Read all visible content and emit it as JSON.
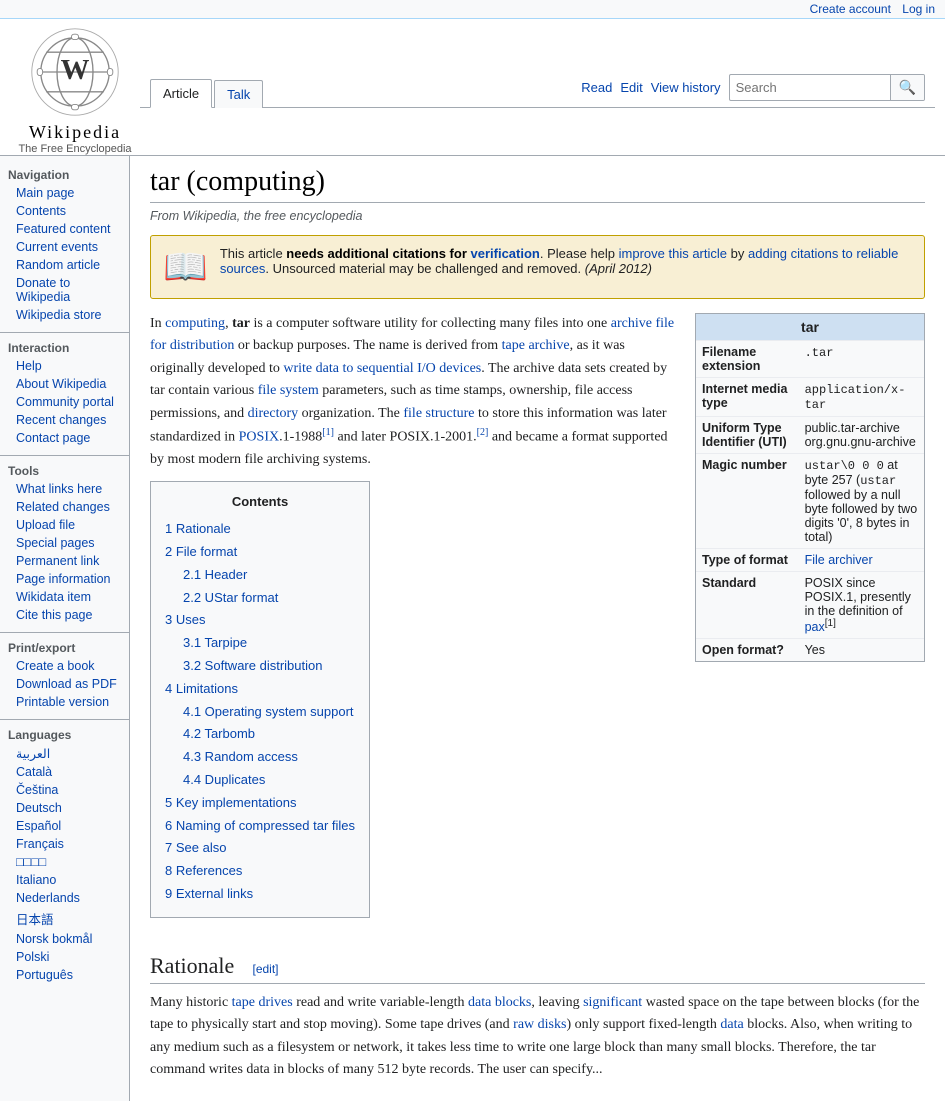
{
  "topbar": {
    "create_account": "Create account",
    "log_in": "Log in"
  },
  "logo": {
    "title": "Wikipedia",
    "subtitle": "The Free Encyclopedia"
  },
  "tabs": {
    "article": "Article",
    "talk": "Talk",
    "read": "Read",
    "edit": "Edit",
    "view_history": "View history"
  },
  "search": {
    "placeholder": "Search",
    "button_label": "🔍"
  },
  "sidebar": {
    "navigation_title": "Navigation",
    "nav_items": [
      {
        "label": "Main page",
        "href": "#"
      },
      {
        "label": "Contents",
        "href": "#"
      },
      {
        "label": "Featured content",
        "href": "#"
      },
      {
        "label": "Current events",
        "href": "#"
      },
      {
        "label": "Random article",
        "href": "#"
      },
      {
        "label": "Donate to Wikipedia",
        "href": "#"
      },
      {
        "label": "Wikipedia store",
        "href": "#"
      }
    ],
    "interaction_title": "Interaction",
    "interaction_items": [
      {
        "label": "Help",
        "href": "#"
      },
      {
        "label": "About Wikipedia",
        "href": "#"
      },
      {
        "label": "Community portal",
        "href": "#"
      },
      {
        "label": "Recent changes",
        "href": "#"
      },
      {
        "label": "Contact page",
        "href": "#"
      }
    ],
    "tools_title": "Tools",
    "tools_items": [
      {
        "label": "What links here",
        "href": "#"
      },
      {
        "label": "Related changes",
        "href": "#"
      },
      {
        "label": "Upload file",
        "href": "#"
      },
      {
        "label": "Special pages",
        "href": "#"
      },
      {
        "label": "Permanent link",
        "href": "#"
      },
      {
        "label": "Page information",
        "href": "#"
      },
      {
        "label": "Wikidata item",
        "href": "#"
      },
      {
        "label": "Cite this page",
        "href": "#"
      }
    ],
    "print_title": "Print/export",
    "print_items": [
      {
        "label": "Create a book",
        "href": "#"
      },
      {
        "label": "Download as PDF",
        "href": "#"
      },
      {
        "label": "Printable version",
        "href": "#"
      }
    ],
    "languages_title": "Languages",
    "language_items": [
      {
        "label": "العربية",
        "href": "#"
      },
      {
        "label": "Català",
        "href": "#"
      },
      {
        "label": "Čeština",
        "href": "#"
      },
      {
        "label": "Deutsch",
        "href": "#"
      },
      {
        "label": "Español",
        "href": "#"
      },
      {
        "label": "Français",
        "href": "#"
      },
      {
        "label": "□□□□",
        "href": "#"
      },
      {
        "label": "Italiano",
        "href": "#"
      },
      {
        "label": "Nederlands",
        "href": "#"
      },
      {
        "label": "日本語",
        "href": "#"
      },
      {
        "label": "Norsk bokmål",
        "href": "#"
      },
      {
        "label": "Polski",
        "href": "#"
      },
      {
        "label": "Português",
        "href": "#"
      }
    ]
  },
  "article": {
    "title": "tar (computing)",
    "subtitle": "From Wikipedia, the free encyclopedia",
    "warning": {
      "text_before": "This article ",
      "bold": "needs additional citations for ",
      "link_verification": "verification",
      "text_after": ". Please help ",
      "link_improve": "improve this article",
      "text_middle": " by adding citations to reliable sources",
      "link_citations": "adding citations to reliable sources",
      "text_end": ". Unsourced material may be challenged and removed.",
      "date": "(April 2012)"
    },
    "intro": "In computing, tar is a computer software utility for collecting many files into one archive file for distribution or backup purposes. The name is derived from tape archive, as it was originally developed to write data to sequential I/O devices. The archive data sets created by tar contain various file system parameters, such as time stamps, ownership, file access permissions, and directory organization. The file structure to store this information was later standardized in POSIX.1-1988[1] and later POSIX.1-2001.[2] and became a format supported by most modern file archiving systems.",
    "infobox": {
      "title": "tar",
      "rows": [
        {
          "label": "Filename extension",
          "value": ".tar"
        },
        {
          "label": "Internet media type",
          "value": "application/x-tar"
        },
        {
          "label": "Uniform Type Identifier (UTI)",
          "value": "public.tar-archive org.gnu.gnu-archive"
        },
        {
          "label": "Magic number",
          "value": "ustar\\0 0 0 at byte 257 (ustar followed by a null byte followed by two digits '0', 8 bytes in total)"
        },
        {
          "label": "Type of format",
          "value": "File archiver"
        },
        {
          "label": "Standard",
          "value": "POSIX since POSIX.1, presently in the definition of pax[1]"
        },
        {
          "label": "Open format?",
          "value": "Yes"
        }
      ]
    },
    "toc": {
      "title": "Contents",
      "items": [
        {
          "num": "1",
          "label": "Rationale",
          "href": "#rationale"
        },
        {
          "num": "2",
          "label": "File format",
          "href": "#file-format",
          "sub": [
            {
              "num": "2.1",
              "label": "Header",
              "href": "#header"
            },
            {
              "num": "2.2",
              "label": "UStar format",
              "href": "#ustar-format"
            }
          ]
        },
        {
          "num": "3",
          "label": "Uses",
          "href": "#uses",
          "sub": [
            {
              "num": "3.1",
              "label": "Tarpipe",
              "href": "#tarpipe"
            },
            {
              "num": "3.2",
              "label": "Software distribution",
              "href": "#software-distribution"
            }
          ]
        },
        {
          "num": "4",
          "label": "Limitations",
          "href": "#limitations",
          "sub": [
            {
              "num": "4.1",
              "label": "Operating system support",
              "href": "#os-support"
            },
            {
              "num": "4.2",
              "label": "Tarbomb",
              "href": "#tarbomb"
            },
            {
              "num": "4.3",
              "label": "Random access",
              "href": "#random-access"
            },
            {
              "num": "4.4",
              "label": "Duplicates",
              "href": "#duplicates"
            }
          ]
        },
        {
          "num": "5",
          "label": "Key implementations",
          "href": "#implementations"
        },
        {
          "num": "6",
          "label": "Naming of compressed tar files",
          "href": "#naming"
        },
        {
          "num": "7",
          "label": "See also",
          "href": "#see-also"
        },
        {
          "num": "8",
          "label": "References",
          "href": "#references"
        },
        {
          "num": "9",
          "label": "External links",
          "href": "#external-links"
        }
      ]
    },
    "rationale_title": "Rationale",
    "rationale_edit": "[edit]",
    "rationale_text": "Many historic tape drives read and write variable-length data blocks, leaving significant wasted space on the tape between blocks (for the tape to physically start and stop moving). Some tape drives (and raw disks) only support fixed-length data blocks. Also, when writing to any medium such as a filesystem or network, it takes less time to write one large block than many small blocks. Therefore, the tar command writes data in blocks of many 512 byte records. The user can specify..."
  }
}
